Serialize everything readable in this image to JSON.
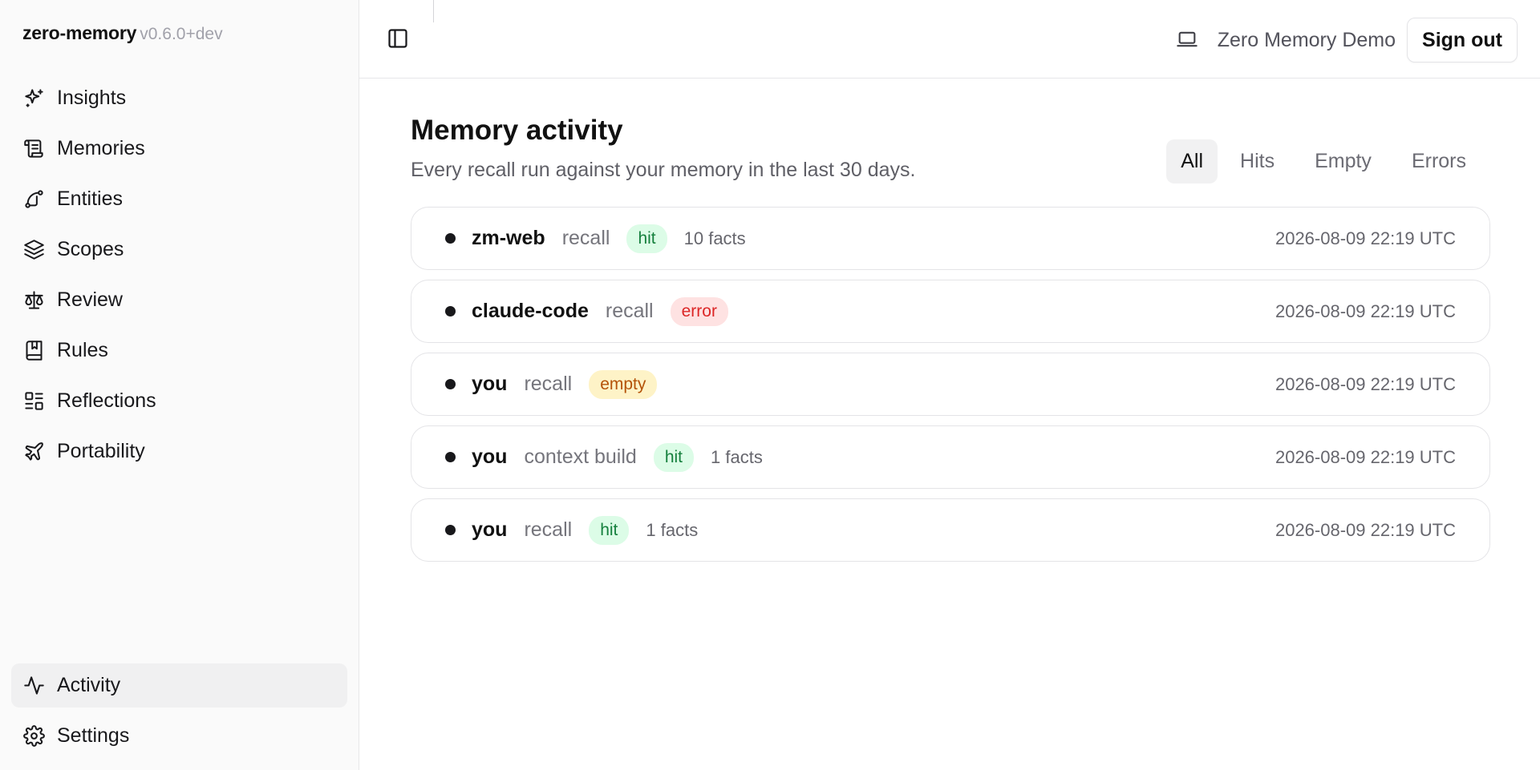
{
  "brand": {
    "name": "zero-memory",
    "version": "v0.6.0+dev"
  },
  "sidebar": {
    "items": [
      {
        "label": "Insights",
        "icon": "sparkles-icon"
      },
      {
        "label": "Memories",
        "icon": "scroll-icon"
      },
      {
        "label": "Entities",
        "icon": "spline-icon"
      },
      {
        "label": "Scopes",
        "icon": "layers-icon"
      },
      {
        "label": "Review",
        "icon": "scale-icon"
      },
      {
        "label": "Rules",
        "icon": "book-marked-icon"
      },
      {
        "label": "Reflections",
        "icon": "grid-icon"
      },
      {
        "label": "Portability",
        "icon": "plane-icon"
      }
    ],
    "bottom": [
      {
        "label": "Activity",
        "icon": "activity-icon",
        "active": true
      },
      {
        "label": "Settings",
        "icon": "gear-icon"
      }
    ]
  },
  "topbar": {
    "org": "Zero Memory Demo",
    "signout": "Sign out"
  },
  "page": {
    "title": "Memory activity",
    "subtitle": "Every recall run against your memory in the last 30 days."
  },
  "filters": [
    {
      "label": "All",
      "active": true
    },
    {
      "label": "Hits"
    },
    {
      "label": "Empty"
    },
    {
      "label": "Errors"
    }
  ],
  "colors": {
    "hit_bg": "#dcfce7",
    "hit_fg": "#15803d",
    "error_bg": "#fee2e2",
    "error_fg": "#dc2626",
    "empty_bg": "#fef3c7",
    "empty_fg": "#b45309"
  },
  "activity": [
    {
      "source": "zm-web",
      "op": "recall",
      "status": "hit",
      "facts": "10 facts",
      "time": "2026-08-09 22:19 UTC"
    },
    {
      "source": "claude-code",
      "op": "recall",
      "status": "error",
      "facts": "",
      "time": "2026-08-09 22:19 UTC"
    },
    {
      "source": "you",
      "op": "recall",
      "status": "empty",
      "facts": "",
      "time": "2026-08-09 22:19 UTC"
    },
    {
      "source": "you",
      "op": "context build",
      "status": "hit",
      "facts": "1 facts",
      "time": "2026-08-09 22:19 UTC"
    },
    {
      "source": "you",
      "op": "recall",
      "status": "hit",
      "facts": "1 facts",
      "time": "2026-08-09 22:19 UTC"
    }
  ]
}
